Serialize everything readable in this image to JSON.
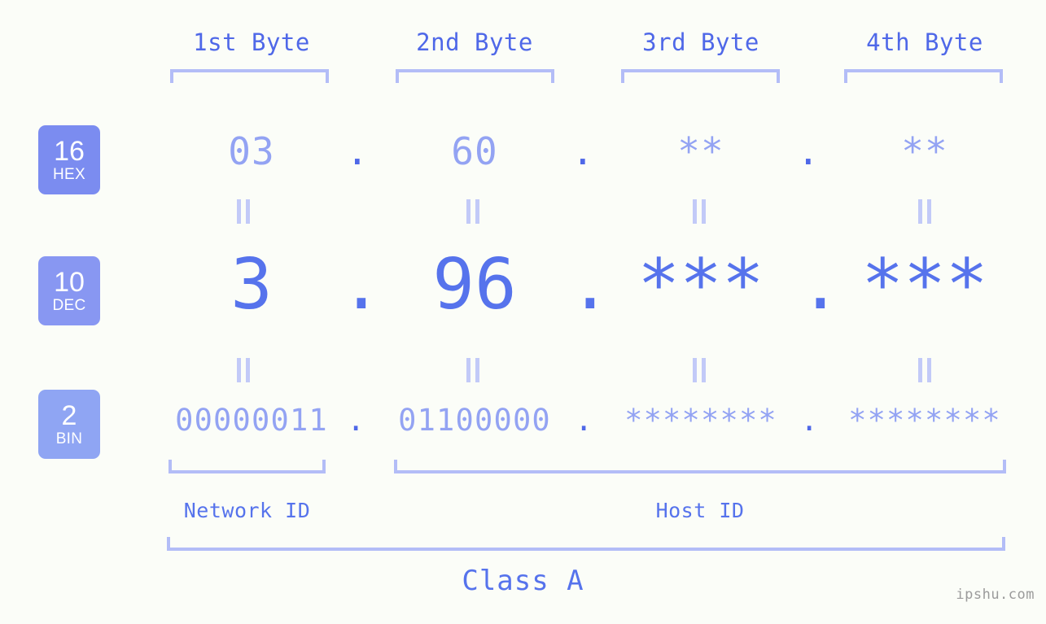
{
  "page": {
    "background_color": "#fbfdf8",
    "accent_color": "#5673ec",
    "accent_light_color": "#93a3f3",
    "bracket_color": "#b3bdf7",
    "badge_color": "#7b8cf0",
    "watermark": "ipshu.com"
  },
  "byte_headers": [
    {
      "label": "1st Byte"
    },
    {
      "label": "2nd Byte"
    },
    {
      "label": "3rd Byte"
    },
    {
      "label": "4th Byte"
    }
  ],
  "radix_rows": [
    {
      "badge_number": "16",
      "badge_name": "HEX",
      "values": [
        "03",
        "60",
        "**",
        "**"
      ],
      "separators": [
        ".",
        ".",
        "."
      ]
    },
    {
      "badge_number": "10",
      "badge_name": "DEC",
      "values": [
        "3",
        "96",
        "***",
        "***"
      ],
      "separators": [
        ".",
        ".",
        "."
      ]
    },
    {
      "badge_number": "2",
      "badge_name": "BIN",
      "values": [
        "00000011",
        "01100000",
        "********",
        "********"
      ],
      "separators": [
        ".",
        ".",
        "."
      ]
    }
  ],
  "equivalence_marks": {
    "row1": [
      "=",
      "=",
      "=",
      "="
    ],
    "row2": [
      "=",
      "=",
      "=",
      "="
    ]
  },
  "id_regions": [
    {
      "label": "Network ID"
    },
    {
      "label": "Host ID"
    }
  ],
  "class": {
    "label": "Class A"
  }
}
